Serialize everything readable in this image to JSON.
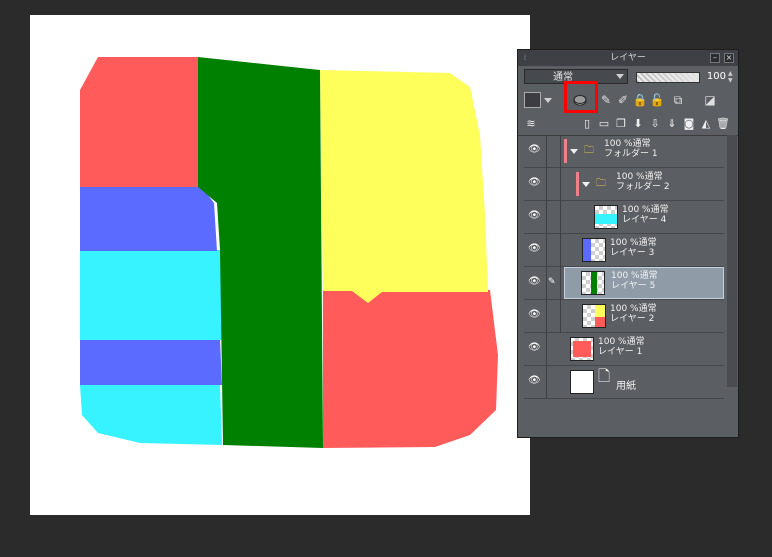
{
  "panel": {
    "title": "レイヤー",
    "blend_mode": "通常",
    "opacity": "100"
  },
  "colors": {
    "red": "#ff5b5b",
    "green": "#008000",
    "yellow": "#ffff5b",
    "blue": "#5b6bff",
    "cyan": "#37f2ff",
    "panel_bg": "#5b5e63",
    "highlight": "#ff0000"
  },
  "layers": [
    {
      "line1": "100 %通常",
      "line2": "フォルダー 1",
      "type": "folder"
    },
    {
      "line1": "100 %通常",
      "line2": "フォルダー 2",
      "type": "folder"
    },
    {
      "line1": "100 %通常",
      "line2": "レイヤー 4",
      "type": "raster"
    },
    {
      "line1": "100 %通常",
      "line2": "レイヤー 3",
      "type": "raster"
    },
    {
      "line1": "100 %通常",
      "line2": "レイヤー 5",
      "type": "raster",
      "selected": true
    },
    {
      "line1": "100 %通常",
      "line2": "レイヤー 2",
      "type": "raster"
    },
    {
      "line1": "100 %通常",
      "line2": "レイヤー 1",
      "type": "raster"
    },
    {
      "line1": "",
      "line2": "用紙",
      "type": "paper"
    }
  ]
}
